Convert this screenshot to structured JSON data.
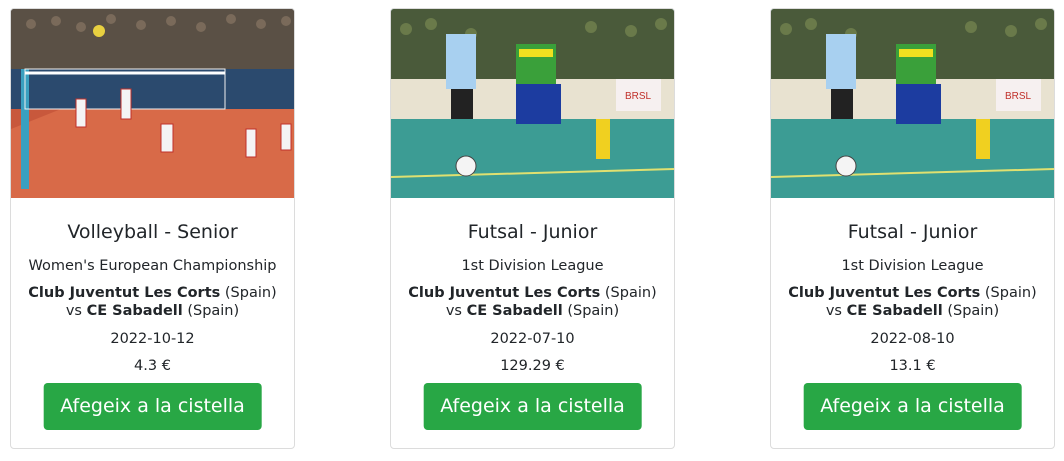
{
  "cards": [
    {
      "title": "Volleyball - Senior",
      "competition": "Women's European Championship",
      "home_team": "Club Juventut Les Corts",
      "home_country": "(Spain)",
      "vs": "vs",
      "away_team": "CE Sabadell",
      "away_country": "(Spain)",
      "date": "2022-10-12",
      "price": "4.3 €",
      "button_label": "Afegeix a la cistella",
      "image": "volleyball-photo"
    },
    {
      "title": "Futsal - Junior",
      "competition": "1st Division League",
      "home_team": "Club Juventut Les Corts",
      "home_country": "(Spain)",
      "vs": "vs",
      "away_team": "CE Sabadell",
      "away_country": "(Spain)",
      "date": "2022-07-10",
      "price": "129.29 €",
      "button_label": "Afegeix a la cistella",
      "image": "futsal-photo"
    },
    {
      "title": "Futsal - Junior",
      "competition": "1st Division League",
      "home_team": "Club Juventut Les Corts",
      "home_country": "(Spain)",
      "vs": "vs",
      "away_team": "CE Sabadell",
      "away_country": "(Spain)",
      "date": "2022-08-10",
      "price": "13.1 €",
      "button_label": "Afegeix a la cistella",
      "image": "futsal-photo"
    }
  ],
  "colors": {
    "button": "#28a745",
    "button_text": "#ffffff",
    "card_border": "#dcdcdc"
  }
}
